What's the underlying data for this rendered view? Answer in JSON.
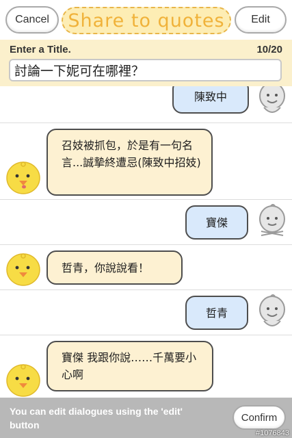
{
  "header": {
    "cancel_label": "Cancel",
    "title": "Share to quotes",
    "edit_label": "Edit"
  },
  "title_section": {
    "label": "Enter a Title.",
    "counter": "10/20",
    "value": "討論一下妮可在哪裡？"
  },
  "messages": [
    {
      "side": "right",
      "text": "陳致中"
    },
    {
      "side": "left",
      "text": "召妓被抓包，於是有一句名言...誠摯終遭忌(陳致中招妓)"
    },
    {
      "side": "right",
      "text": "寶傑"
    },
    {
      "side": "left",
      "text": "哲青，你說說看！"
    },
    {
      "side": "right",
      "text": "哲青"
    },
    {
      "side": "left",
      "text": "寶傑 我跟你說……千萬要小心啊"
    }
  ],
  "footer": {
    "hint": "You can edit dialogues using the 'edit' button",
    "confirm_label": "Confirm"
  },
  "watermark": "#1076843",
  "colors": {
    "title_bg": "#fbf0cc",
    "title_pill": "#fdedb4",
    "title_text": "#f0b23a",
    "right_bubble": "#d9e9fb",
    "left_bubble": "#fdf1d2",
    "footer_bg": "#b8b8b8",
    "chick_yellow": "#f7dc45"
  },
  "icons": {
    "user_avatar": "simsimi-grey-avatar",
    "bot_avatar": "simsimi-yellow-chick"
  }
}
